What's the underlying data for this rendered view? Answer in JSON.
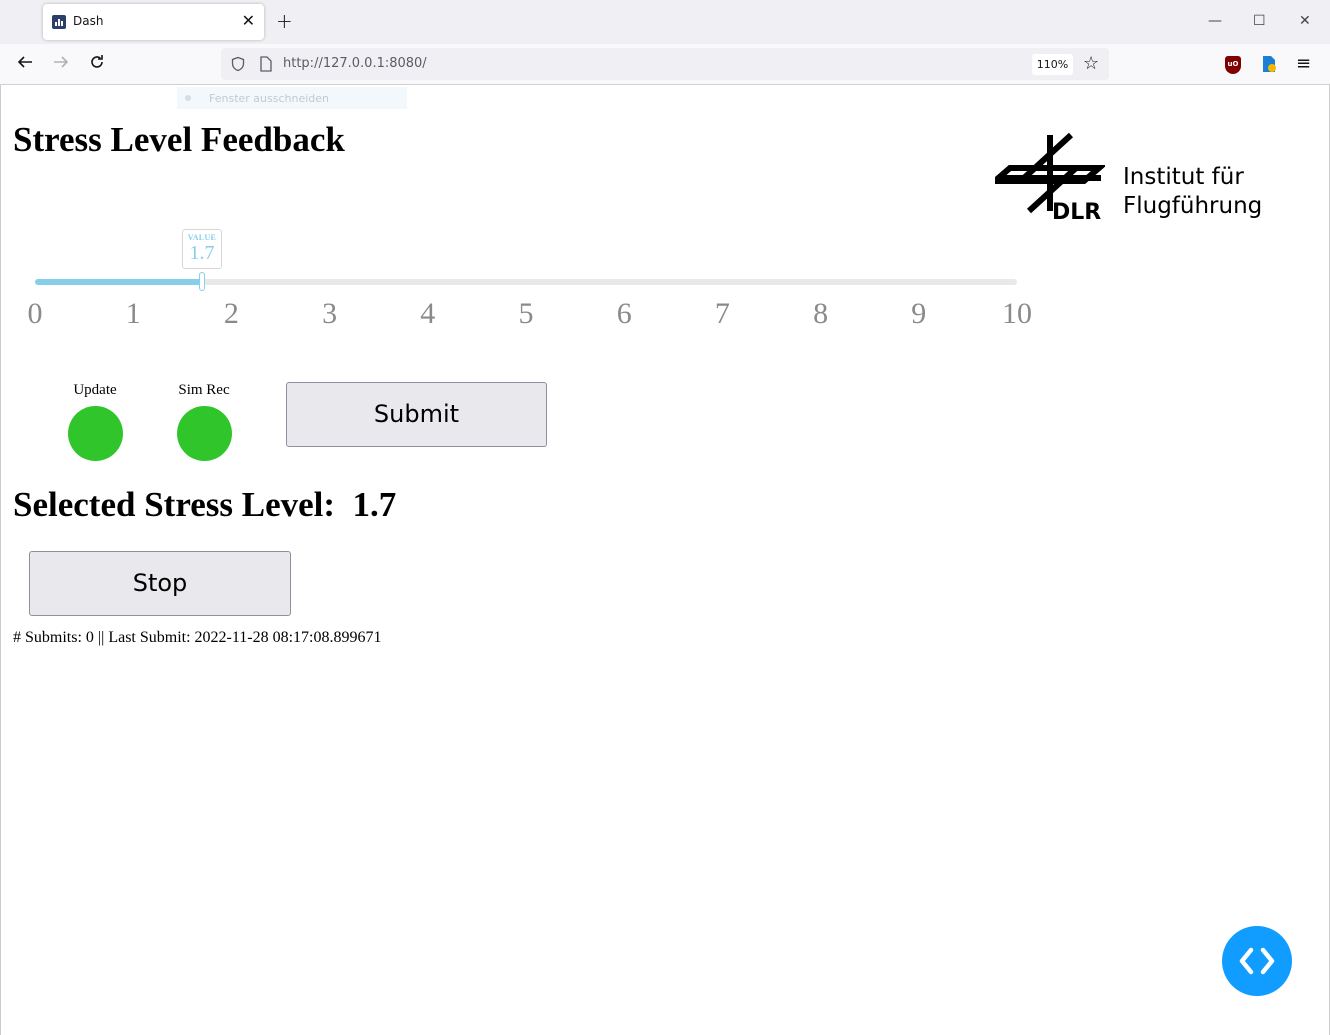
{
  "browser": {
    "tab_title": "Dash",
    "tab_close": "✕",
    "new_tab": "+",
    "url": "http://127.0.0.1:8080/",
    "zoom": "110%",
    "window_controls": {
      "minimize": "—",
      "maximize": "☐",
      "close": "✕"
    }
  },
  "ghost_tooltip": "Fenster ausschneiden",
  "page": {
    "title": "Stress Level Feedback",
    "logo": {
      "line1": "Institut für",
      "line2": "Flugführung",
      "brand": "DLR"
    },
    "slider": {
      "min": 0,
      "max": 10,
      "value": 1.7,
      "value_caption": "VALUE",
      "value_display": "1.7",
      "ticks": [
        "0",
        "1",
        "2",
        "3",
        "4",
        "5",
        "6",
        "7",
        "8",
        "9",
        "10"
      ],
      "accent_color": "#87ceeb"
    },
    "indicators": [
      {
        "label": "Update",
        "color": "#30c52a"
      },
      {
        "label": "Sim Rec",
        "color": "#30c52a"
      }
    ],
    "submit_label": "Submit",
    "selected_text": "Selected Stress Level:  1.7",
    "stop_label": "Stop",
    "status": "# Submits: 0 || Last Submit: 2022-11-28 08:17:08.899671"
  },
  "debug_button_color": "#119dff"
}
